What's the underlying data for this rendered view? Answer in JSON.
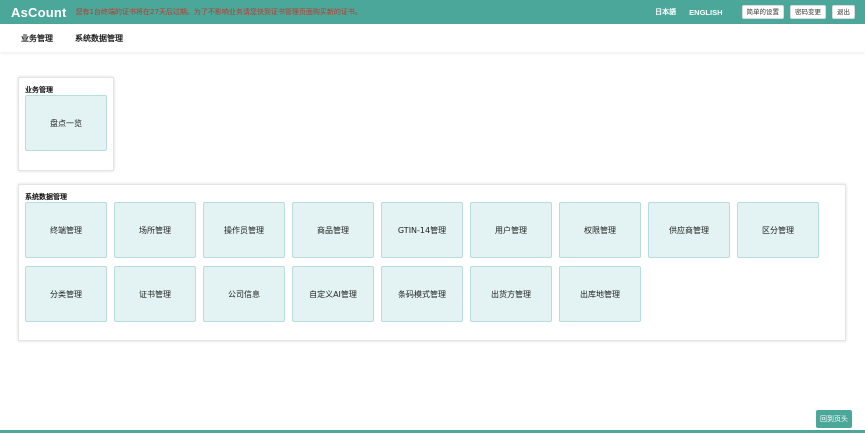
{
  "header": {
    "logo": "AsCount",
    "notice": "您有1台终端的证书将在27天后过期。为了不影响业务请您快到证书管理页面购买新的证书。",
    "lang_ja": "日本語",
    "lang_en": "ENGLISH",
    "buttons": [
      "简单的设置",
      "密码变更",
      "退出"
    ]
  },
  "nav": {
    "items": [
      "业务管理",
      "系统数据管理"
    ]
  },
  "business_panel": {
    "title": "业务管理",
    "tiles": [
      "盘点一览"
    ]
  },
  "system_panel": {
    "title": "系统数据管理",
    "row1": [
      "终端管理",
      "场所管理",
      "操作员管理",
      "商品管理",
      "GTIN-14管理",
      "用户管理",
      "权限管理",
      "供应商管理",
      "区分管理"
    ],
    "row2": [
      "分类管理",
      "证书管理",
      "公司信息",
      "自定义AI管理",
      "条码模式管理",
      "出货方管理",
      "出库地管理"
    ]
  },
  "back_to_top": "回到页头",
  "colors": {
    "accent": "#4aa79a",
    "notice": "#c0392b",
    "tile_bg": "#e3f2f2"
  }
}
